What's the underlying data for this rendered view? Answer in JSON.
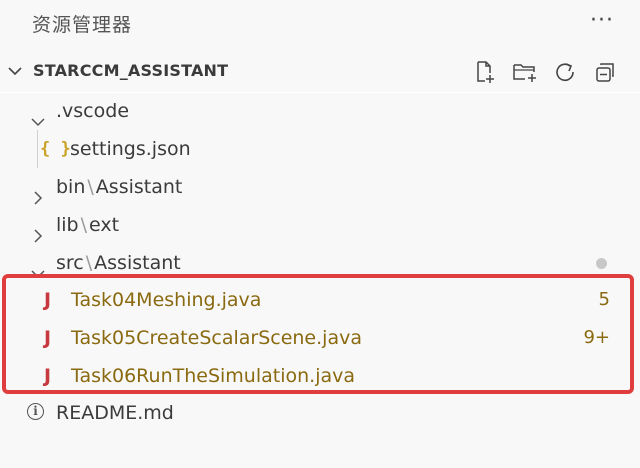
{
  "header": {
    "title": "资源管理器",
    "more_label": "···"
  },
  "section": {
    "title": "STARCCM_ASSISTANT",
    "actions": [
      "new-file-icon",
      "new-folder-icon",
      "refresh-icon",
      "collapse-all-icon"
    ]
  },
  "tree": {
    "vscode": {
      "name": ".vscode"
    },
    "settings": {
      "icon": "{ }",
      "name": "settings.json"
    },
    "bin": {
      "part1": "bin",
      "sep": "\\",
      "part2": "Assistant"
    },
    "lib": {
      "part1": "lib",
      "sep": "\\",
      "part2": "ext"
    },
    "src": {
      "part1": "src",
      "sep": "\\",
      "part2": "Assistant"
    },
    "files": [
      {
        "icon": "J",
        "name": "Task04Meshing.java",
        "badge": "5"
      },
      {
        "icon": "J",
        "name": "Task05CreateScalarScene.java",
        "badge": "9+"
      },
      {
        "icon": "J",
        "name": "Task06RunTheSimulation.java",
        "badge": ""
      }
    ],
    "readme": {
      "icon": "i",
      "name": "README.md"
    }
  },
  "colors": {
    "highlight": "#e03e3e",
    "java_icon": "#c5393f",
    "warning_text": "#8a6a10",
    "json_icon": "#c9a227"
  }
}
